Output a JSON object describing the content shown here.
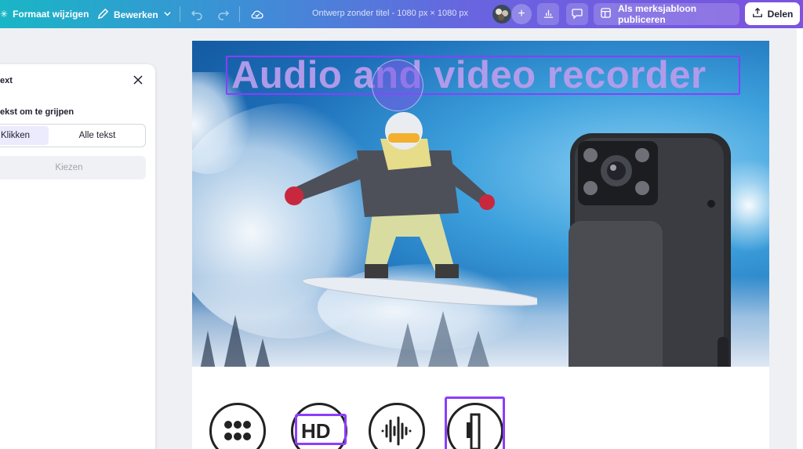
{
  "topbar": {
    "resize_label": "Formaat wijzigen",
    "edit_label": "Bewerken",
    "doc_title": "Ontwerp zonder titel - 1080 px × 1080 px",
    "publish_label": "Als merksjabloon publiceren",
    "share_label": "Delen"
  },
  "panel": {
    "title": "ext",
    "subtitle": "ekst om te grijpen",
    "option_click": "Klikken",
    "option_all": "Alle tekst",
    "choose_label": "Kiezen"
  },
  "canvas": {
    "headline": "Audio and video recorder",
    "hd_label": "HD"
  },
  "colors": {
    "accent": "#8b3dff",
    "headline": "#b79dec"
  }
}
